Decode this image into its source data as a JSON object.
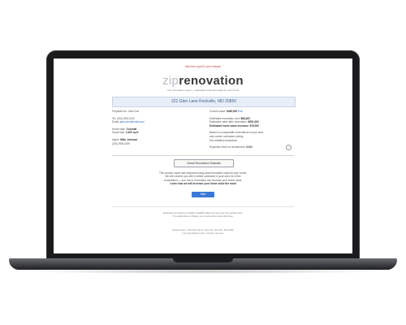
{
  "email": {
    "top_note": "View this report in your browser",
    "logo": {
      "part1": "zip",
      "part2": "renovation"
    },
    "tagline": "Your renovation report — estimated costs and value for your home",
    "address": "221 Glen Lane Rockville, MD 20850",
    "left_column": {
      "prepared_for": "Prepared for: Jane Doe",
      "phone_label": "Tel:",
      "phone": "(301) 555-0142",
      "email_label": "Email:",
      "email": "jane.doe@email.com",
      "home_style_label": "Home style:",
      "home_style": "Colonial",
      "home_size_label": "Home size:",
      "home_size": "2,400 sq ft",
      "agent_label": "Agent:",
      "agent": "Mike Johnson",
      "agent_phone": "(301) 555-0199"
    },
    "right_column": {
      "current_value_label": "Current value:",
      "current_value": "$485,000",
      "edit_link": "Edit",
      "est_renovation_label": "Estimated renovation cost:",
      "est_renovation": "$68,400",
      "value_after_label": "Estimated value after renovation:",
      "value_after": "$561,000",
      "value_increase_label": "Estimated home value increase:",
      "value_increase": "$76,000",
      "note_line1": "Based on comparable renovations in your area",
      "note_line2": "and current contractor pricing",
      "details_label": "See detailed breakdown",
      "return_label": "Expected return on investment:",
      "return_value": "111%"
    },
    "virtual_button": "Virtual Renovation Estimate",
    "paragraph": {
      "line1": "This custom report was prepared using local renovation costs for your home.",
      "line2": "We will connect you with a vetted contractor in your area for a free",
      "line3": "consultation — see how a renovation can increase your home value.",
      "line4": "Learn how we will increase your home value the most"
    },
    "cta_button": "Start",
    "fine_print": {
      "line1": "Estimates are based on publicly available data and may vary from actual costs.",
      "line2": "To unsubscribe or change your email preferences click here."
    },
    "footer": {
      "line1": "ZipRenovation, 1234 Main Street, Suite 100, Rockville, MD 20850",
      "line2": "Copyright ZipRenovation. All rights reserved."
    }
  }
}
